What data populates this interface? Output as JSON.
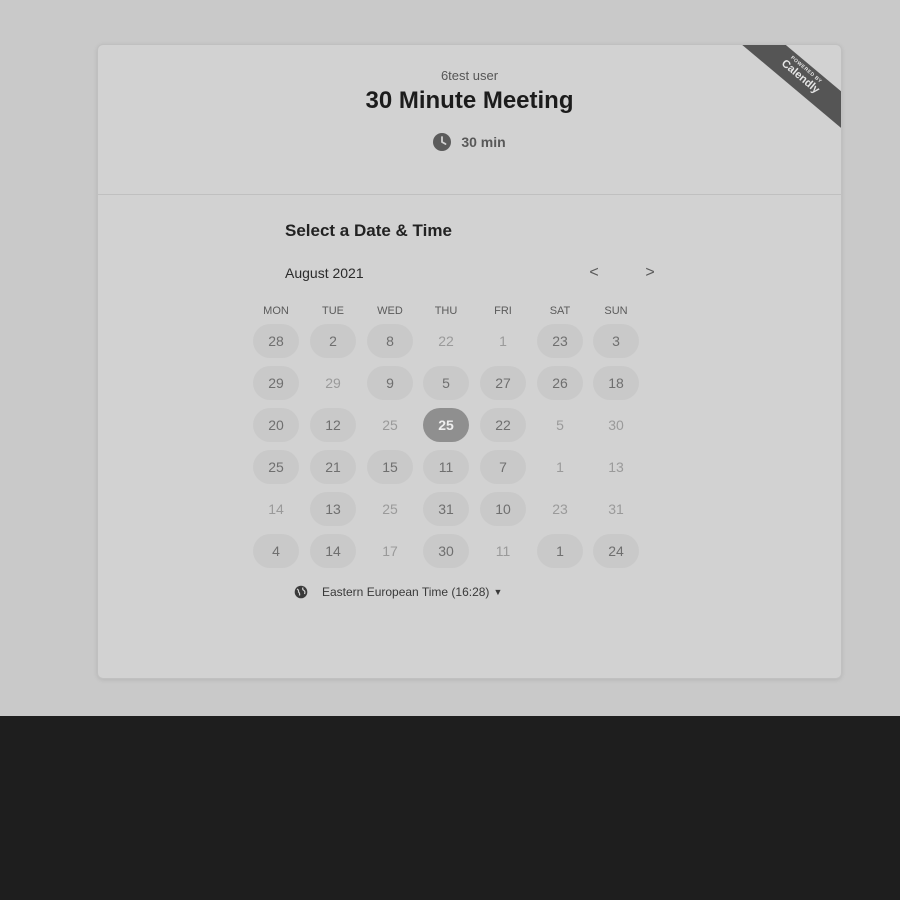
{
  "header": {
    "owner": "6test user",
    "title": "30 Minute Meeting",
    "duration": "30 min",
    "duration_icon": "clock-icon"
  },
  "ribbon": {
    "small": "POWERED BY",
    "brand": "Calendly"
  },
  "scheduler": {
    "section_title": "Select a Date & Time",
    "month_label": "August 2021",
    "prev_label": "<",
    "next_label": ">",
    "weekdays": [
      "MON",
      "TUE",
      "WED",
      "THU",
      "FRI",
      "SAT",
      "SUN"
    ],
    "weeks": [
      [
        {
          "d": "28",
          "a": true
        },
        {
          "d": "2",
          "a": true
        },
        {
          "d": "8",
          "a": true
        },
        {
          "d": "22",
          "a": false
        },
        {
          "d": "1",
          "a": false
        },
        {
          "d": "23",
          "a": true
        },
        {
          "d": "3",
          "a": true
        }
      ],
      [
        {
          "d": "29",
          "a": true
        },
        {
          "d": "29",
          "a": false
        },
        {
          "d": "9",
          "a": true
        },
        {
          "d": "5",
          "a": true
        },
        {
          "d": "27",
          "a": true
        },
        {
          "d": "26",
          "a": true
        },
        {
          "d": "18",
          "a": true
        }
      ],
      [
        {
          "d": "20",
          "a": true
        },
        {
          "d": "12",
          "a": true
        },
        {
          "d": "25",
          "a": false
        },
        {
          "d": "25",
          "a": true,
          "s": true
        },
        {
          "d": "22",
          "a": true
        },
        {
          "d": "5",
          "a": false
        },
        {
          "d": "30",
          "a": false
        }
      ],
      [
        {
          "d": "25",
          "a": true
        },
        {
          "d": "21",
          "a": true
        },
        {
          "d": "15",
          "a": true
        },
        {
          "d": "11",
          "a": true
        },
        {
          "d": "7",
          "a": true
        },
        {
          "d": "1",
          "a": false
        },
        {
          "d": "13",
          "a": false
        }
      ],
      [
        {
          "d": "14",
          "a": false
        },
        {
          "d": "13",
          "a": true
        },
        {
          "d": "25",
          "a": false
        },
        {
          "d": "31",
          "a": true
        },
        {
          "d": "10",
          "a": true
        },
        {
          "d": "23",
          "a": false
        },
        {
          "d": "31",
          "a": false
        }
      ],
      [
        {
          "d": "4",
          "a": true
        },
        {
          "d": "14",
          "a": true
        },
        {
          "d": "17",
          "a": false
        },
        {
          "d": "30",
          "a": true
        },
        {
          "d": "11",
          "a": false
        },
        {
          "d": "1",
          "a": true
        },
        {
          "d": "24",
          "a": true
        }
      ]
    ],
    "timezone": "Eastern European Time (16:28)",
    "timezone_icon": "globe-icon"
  },
  "colors": {
    "page_bg": "#c9c9c9",
    "card_bg": "#d2d2d2",
    "footer_bg": "#1e1e1e",
    "selected": "#8f8f8f",
    "ribbon": "#555555"
  }
}
